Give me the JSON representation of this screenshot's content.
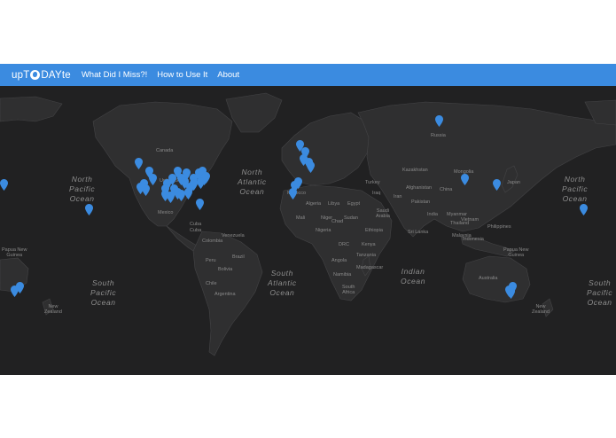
{
  "navbar": {
    "brand": {
      "prefix": "upT",
      "suffix": "DAYte"
    },
    "links": [
      "What Did I Miss?!",
      "How to Use It",
      "About"
    ]
  },
  "map": {
    "ocean_labels": [
      "North\nPacific\nOcean",
      "North\nAtlantic\nOcean",
      "South\nAtlantic\nOcean",
      "Indian\nOcean",
      "South\nPacific\nOcean",
      "North\nPacific\nOcean",
      "South\nPacific\nOcean"
    ],
    "place_labels": [
      "Russia",
      "Canada",
      "Mexico",
      "Cuba",
      "Venezuela",
      "Colombia",
      "Brazil",
      "Peru",
      "Bolivia",
      "Argentina",
      "Chile",
      "Algeria",
      "Libya",
      "Egypt",
      "Niger",
      "Sudan",
      "Nigeria",
      "DRC",
      "Ethiopia",
      "Kenya",
      "Tanzania",
      "Angola",
      "Namibia",
      "South\nAfrica",
      "Madagascar",
      "Saudi\nArabia",
      "Iran",
      "Pakistan",
      "India",
      "China",
      "Mongolia",
      "Kazakhstan",
      "Sri Lanka",
      "Indonesia",
      "Philippines",
      "Malaysia",
      "Papua New\nGuinea",
      "Australia",
      "New\nZealand",
      "Papua New\nGuinea",
      "New\nZealand",
      "United States",
      "Mali",
      "Chad",
      "Morocco",
      "Turkey",
      "Iraq",
      "Afghanistan",
      "Myanmar",
      "Thailand",
      "Vietnam",
      "Japan",
      "Cuba"
    ],
    "marker_color": "#3b8be0",
    "marker_count": 47,
    "land_color": "#2f2f30",
    "ocean_color": "#212122"
  }
}
